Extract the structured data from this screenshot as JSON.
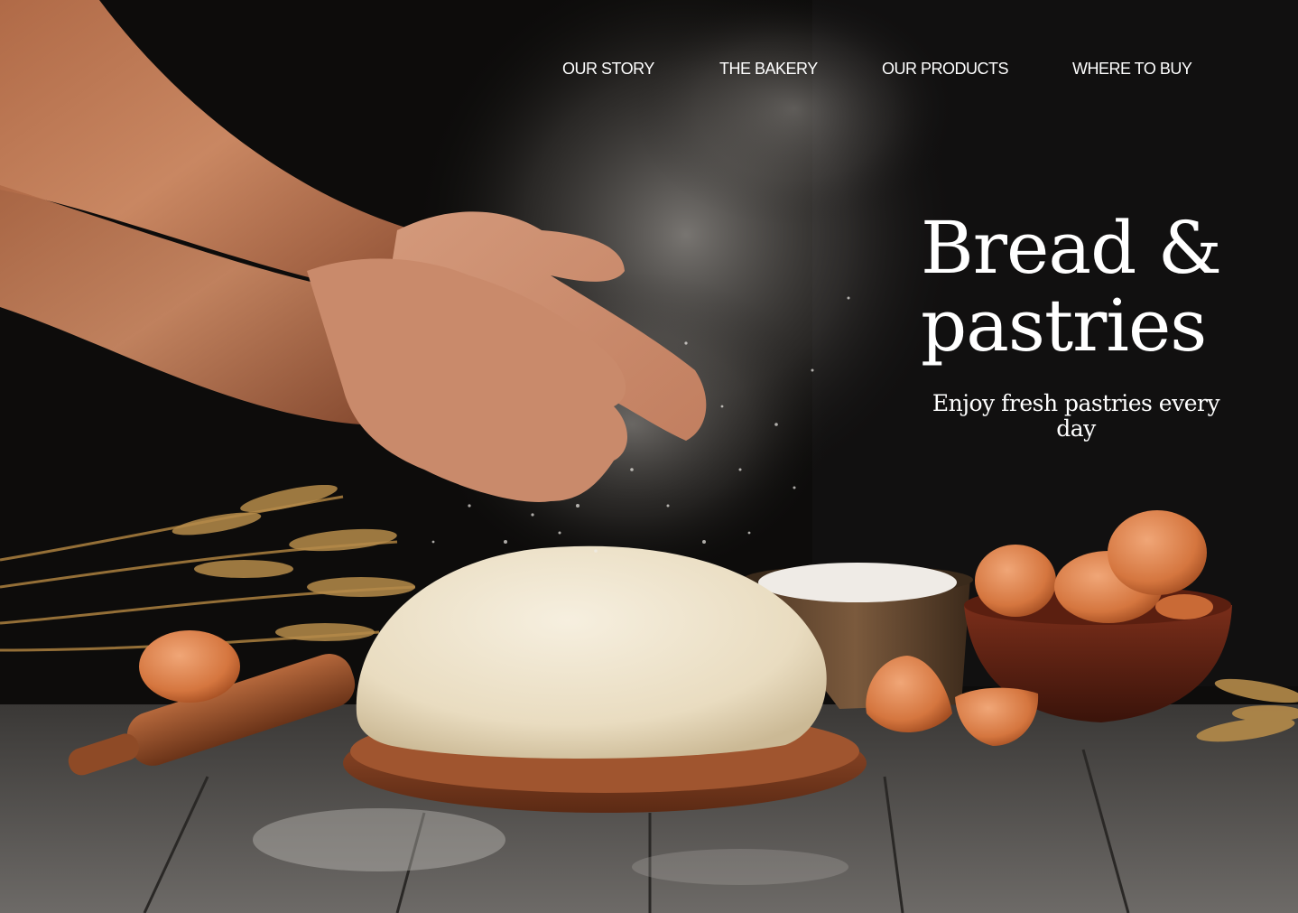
{
  "nav": {
    "items": [
      {
        "label": "OUR STORY"
      },
      {
        "label": "THE BAKERY"
      },
      {
        "label": "OUR PRODUCTS"
      },
      {
        "label": "WHERE TO BUY"
      }
    ]
  },
  "hero": {
    "title": "Bread & pastries",
    "subtitle": "Enjoy fresh pastries every day"
  },
  "colors": {
    "background": "#0c0b0a",
    "text": "#ffffff"
  }
}
